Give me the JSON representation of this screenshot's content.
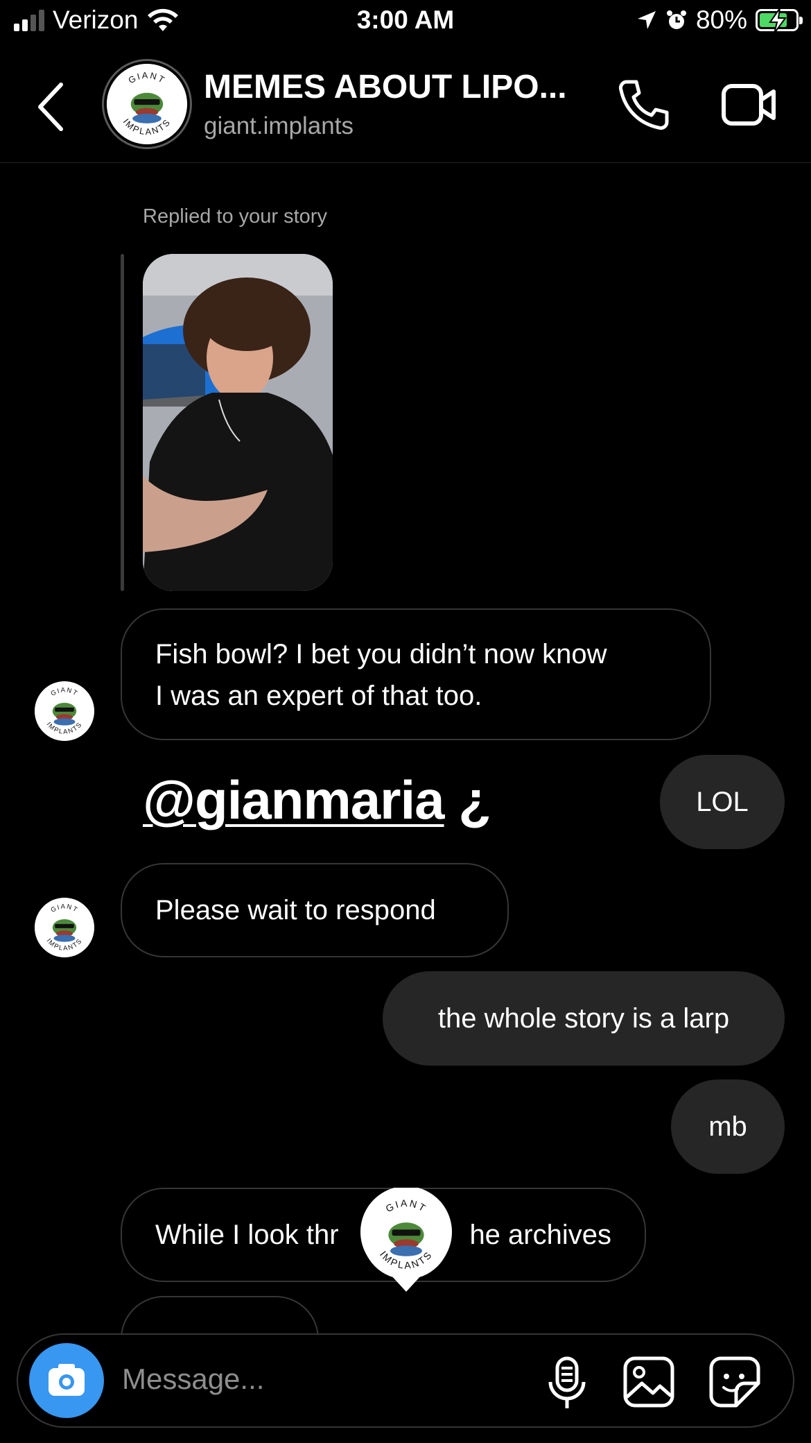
{
  "status_bar": {
    "carrier": "Verizon",
    "time": "3:00 AM",
    "battery": "80%",
    "battery_level": 0.8,
    "icons": [
      "signal-icon",
      "wifi-icon",
      "location-arrow-icon",
      "alarm-icon",
      "battery-charging-icon"
    ]
  },
  "header": {
    "title": "MEMES ABOUT LIPO...",
    "username": "giant.implants",
    "avatar_text_top": "GIANT",
    "avatar_text_bottom": "IMPLANTS",
    "icons": [
      "back-chevron-icon",
      "phone-icon",
      "video-camera-icon"
    ]
  },
  "chat": {
    "replied_label": "Replied to your story",
    "messages": [
      {
        "from": "them",
        "text_line1": "Fish bowl? I bet you didn’t now know",
        "text_line2": "I was an expert of that too."
      },
      {
        "from": "me",
        "text": "LOL"
      },
      {
        "from": "them",
        "text": "Please wait to respond"
      },
      {
        "from": "me",
        "text": "the whole story is a larp"
      },
      {
        "from": "me",
        "text": "mb"
      },
      {
        "from": "them",
        "text_left": "While I look thr",
        "text_right": "he archives"
      }
    ],
    "sticker_mention": "@gianmaria",
    "sticker_suffix": " ¿"
  },
  "composer": {
    "placeholder": "Message...",
    "icons": [
      "camera-icon",
      "microphone-icon",
      "gallery-icon",
      "sticker-icon"
    ]
  },
  "colors": {
    "background": "#000000",
    "outgoing_bubble": "#262626",
    "incoming_border": "#363636",
    "camera_button": "#3897f0",
    "battery_fill": "#4cd964",
    "muted_text": "#a8a8a8"
  }
}
